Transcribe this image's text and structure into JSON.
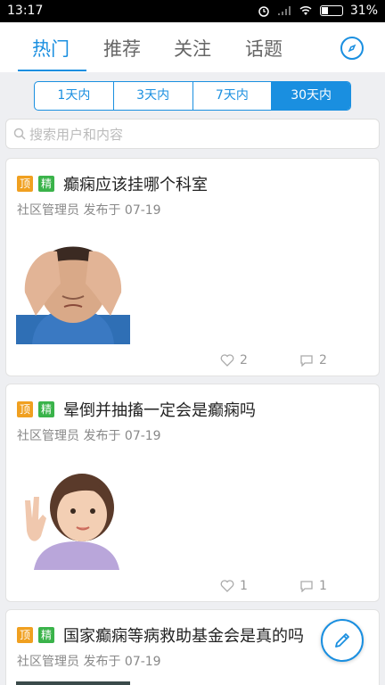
{
  "status_bar": {
    "time": "13:17",
    "battery": "31%",
    "battery_level": 0.31
  },
  "tabs": [
    {
      "label": "热门",
      "active": true
    },
    {
      "label": "推荐",
      "active": false
    },
    {
      "label": "关注",
      "active": false
    },
    {
      "label": "话题",
      "active": false
    }
  ],
  "time_filter": [
    "1天内",
    "3天内",
    "7天内",
    "30天内"
  ],
  "time_filter_selected": "30天内",
  "search": {
    "placeholder": "搜索用户和内容"
  },
  "badges": {
    "top": "顶",
    "essence": "精"
  },
  "posts": [
    {
      "title": "癫痫应该挂哪个科室",
      "author": "社区管理员",
      "published_label": "发布于",
      "date": "07-19",
      "likes": "2",
      "comments": "2",
      "image": "man-holding-head"
    },
    {
      "title": "晕倒并抽搐一定会是癫痫吗",
      "author": "社区管理员",
      "published_label": "发布于",
      "date": "07-19",
      "likes": "1",
      "comments": "1",
      "image": "toddler-waving"
    },
    {
      "title": "国家癫痫等病救助基金会是真的吗",
      "author": "社区管理员",
      "published_label": "发布于",
      "date": "07-19",
      "likes": "",
      "comments": "",
      "image": ""
    }
  ],
  "icons": {
    "compass": "compass-icon",
    "search": "search-icon",
    "like": "heart-outline-icon",
    "comment": "comment-bubble-icon",
    "compose": "pencil-icon",
    "wifi": "wifi-icon",
    "signal": "signal-icon",
    "alarm": "alarm-icon"
  },
  "colors": {
    "accent": "#1a8fe0",
    "top_badge": "#f0a020",
    "essence_badge": "#3ab34a"
  }
}
